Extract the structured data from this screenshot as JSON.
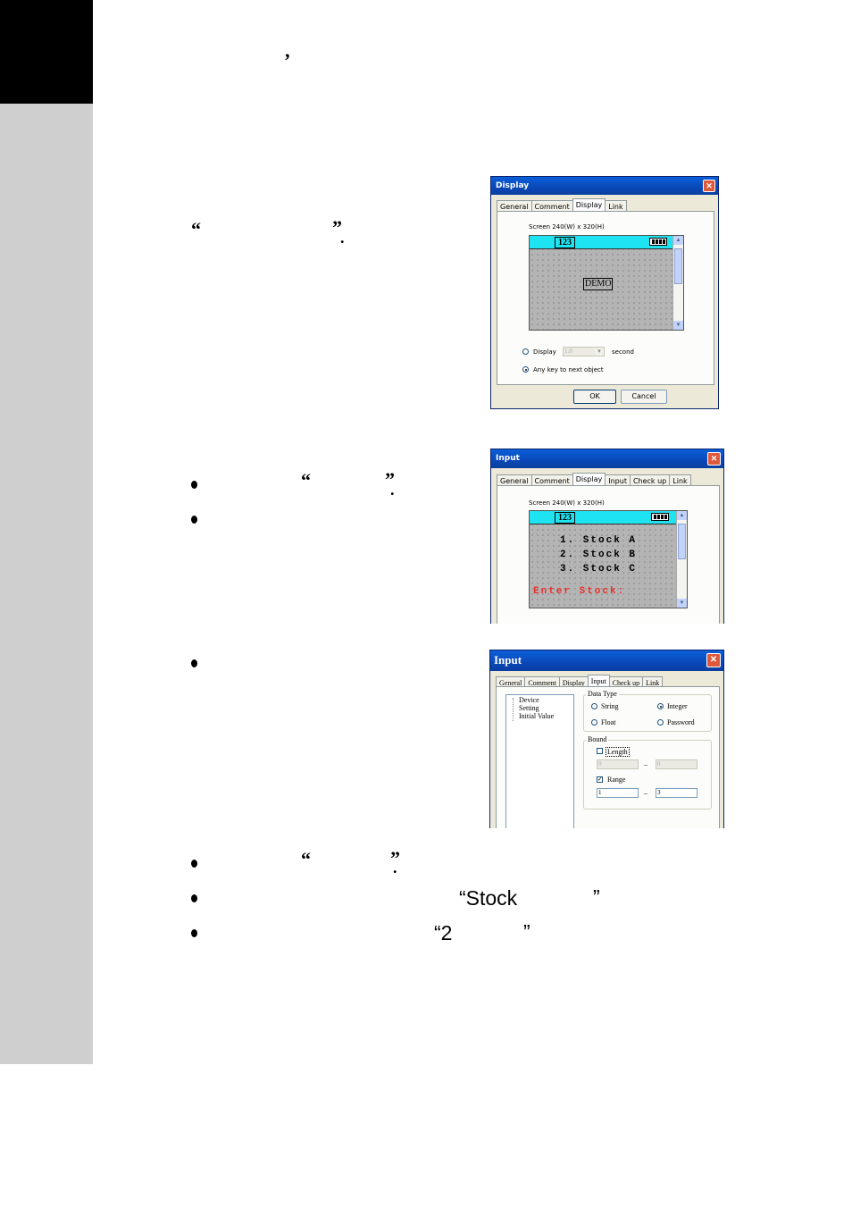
{
  "page": {
    "marks": {
      "comma": "’",
      "quote_open": "“",
      "quote_close": "”",
      "period": "."
    },
    "text_stock": "“Stock",
    "text_stock_close": "”",
    "text_two": "“2",
    "text_two_close": "”"
  },
  "dialog_display": {
    "title": "Display",
    "close_glyph": "✕",
    "tabs": [
      "General",
      "Comment",
      "Display",
      "Link"
    ],
    "screen_label": "Screen 240(W) x 320(H)",
    "screen_number": "123",
    "demo_text": "DEMO",
    "radio_display": "Display",
    "display_value": "1.0",
    "dropdown_glyph": "▾",
    "second_label": "second",
    "radio_anykey": "Any key to next object",
    "ok_label": "OK",
    "cancel_label": "Cancel"
  },
  "dialog_input_display": {
    "title": "Input",
    "close_glyph": "✕",
    "tabs": [
      "General",
      "Comment",
      "Display",
      "Input",
      "Check up",
      "Link"
    ],
    "screen_label": "Screen 240(W) x 320(H)",
    "screen_number": "123",
    "lines": [
      "1. Stock A",
      "2. Stock B",
      "3. Stock C"
    ],
    "prompt": "Enter Stock:"
  },
  "dialog_input_input": {
    "title": "Input",
    "close_glyph": "✕",
    "tabs": [
      "General",
      "Comment",
      "Display",
      "Input",
      "Check up",
      "Link"
    ],
    "tree": [
      "Device",
      "Setting",
      "Initial Value"
    ],
    "data_type_label": "Data Type",
    "string_label": "String",
    "integer_label": "Integer",
    "float_label": "Float",
    "password_label": "Password",
    "bound_label": "Bound",
    "length_label": "Length",
    "length_min": "0",
    "length_max": "0",
    "range_label": "Range",
    "range_min": "1",
    "range_max": "3",
    "dash": "–",
    "check_mark": "✓"
  },
  "colors": {
    "lcd_bar": "#1ee3f0",
    "prompt_red": "#e8302a",
    "title_blue": "#0a48b8"
  }
}
